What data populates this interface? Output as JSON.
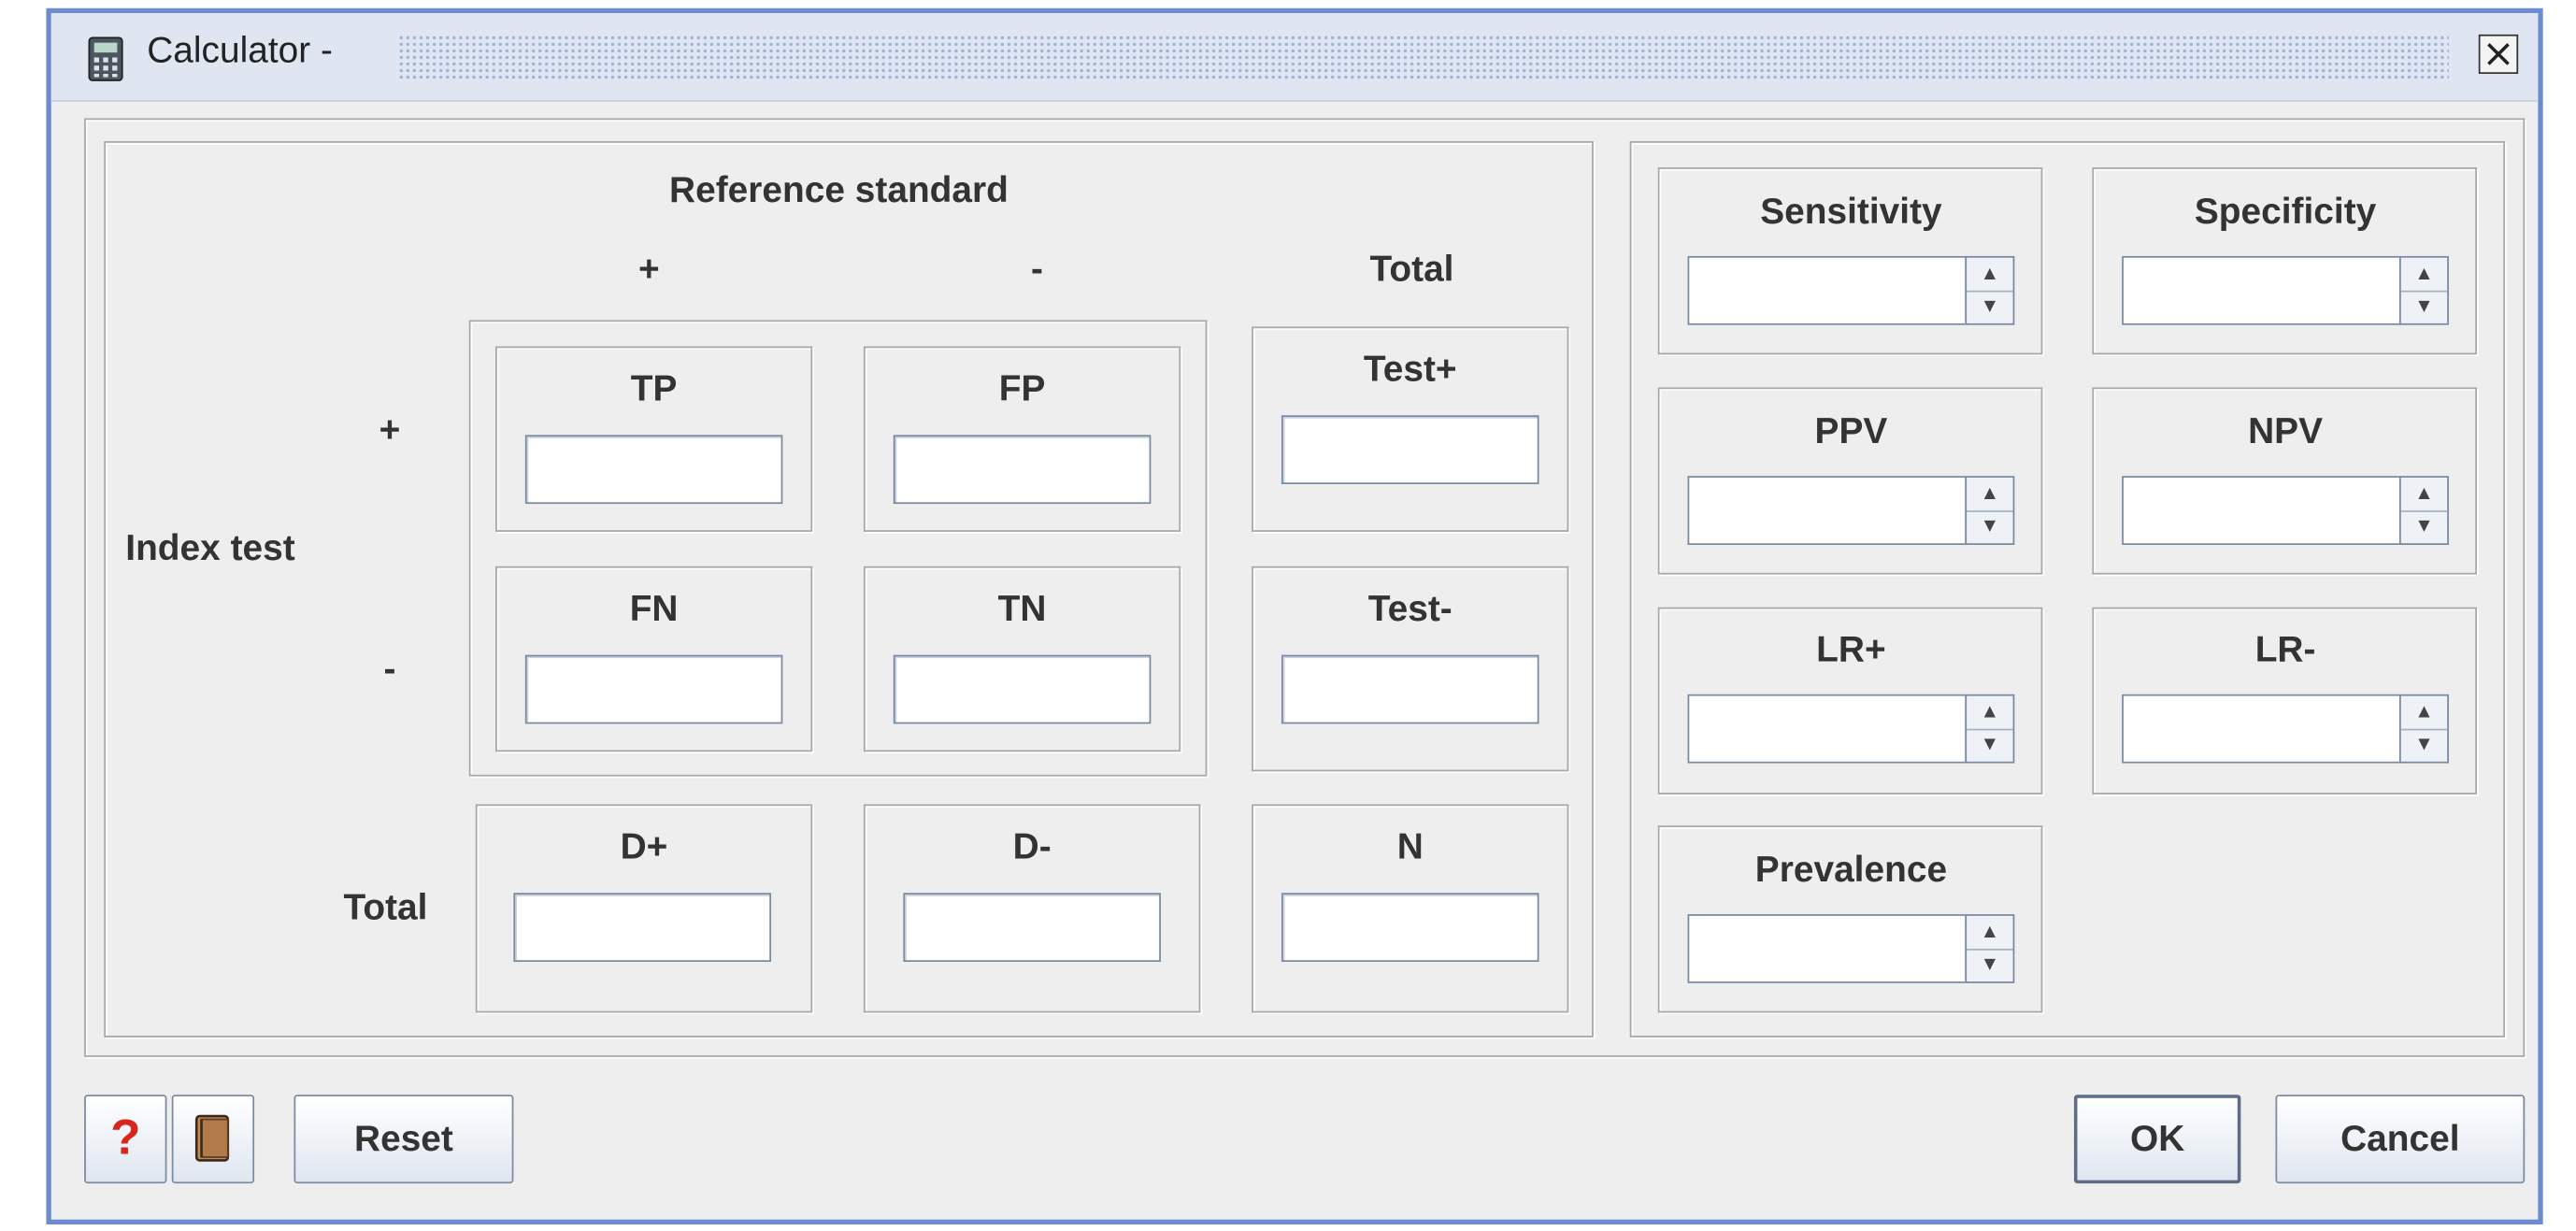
{
  "window": {
    "title": "Calculator -"
  },
  "grid": {
    "reference_standard": "Reference standard",
    "col_plus": "+",
    "col_minus": "-",
    "col_total": "Total",
    "row_plus": "+",
    "row_minus": "-",
    "index_test": "Index test",
    "row_total": "Total",
    "cells": {
      "tp": {
        "label": "TP",
        "value": ""
      },
      "fp": {
        "label": "FP",
        "value": ""
      },
      "fn": {
        "label": "FN",
        "value": ""
      },
      "tn": {
        "label": "TN",
        "value": ""
      },
      "test_pos": {
        "label": "Test+",
        "value": ""
      },
      "test_neg": {
        "label": "Test-",
        "value": ""
      },
      "d_pos": {
        "label": "D+",
        "value": ""
      },
      "d_neg": {
        "label": "D-",
        "value": ""
      },
      "n": {
        "label": "N",
        "value": ""
      }
    }
  },
  "stats": {
    "sensitivity": {
      "label": "Sensitivity",
      "value": ""
    },
    "specificity": {
      "label": "Specificity",
      "value": ""
    },
    "ppv": {
      "label": "PPV",
      "value": ""
    },
    "npv": {
      "label": "NPV",
      "value": ""
    },
    "lr_pos": {
      "label": "LR+",
      "value": ""
    },
    "lr_neg": {
      "label": "LR-",
      "value": ""
    },
    "prevalence": {
      "label": "Prevalence",
      "value": ""
    }
  },
  "buttons": {
    "help_icon": "?",
    "reset": "Reset",
    "ok": "OK",
    "cancel": "Cancel"
  },
  "icons": {
    "title": "calculator-icon",
    "close": "close-icon",
    "help": "help-icon",
    "book": "book-icon"
  },
  "colors": {
    "window_border": "#6b8ccf",
    "background": "#eeeeee",
    "help_icon": "#d9261c",
    "book_icon": "#b07a4a"
  }
}
